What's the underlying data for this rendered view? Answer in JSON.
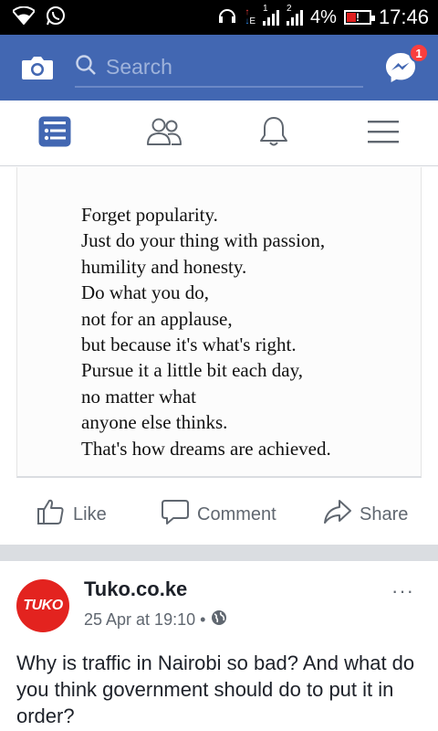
{
  "status_bar": {
    "battery": "4%",
    "time": "17:46",
    "sim1": "1",
    "sim2": "2",
    "network_type": "E"
  },
  "app_bar": {
    "search_placeholder": "Search",
    "messenger_badge": "1",
    "color": "#4267b2"
  },
  "nav_tabs": [
    {
      "name": "news-feed",
      "icon": "news-feed-icon",
      "active": true
    },
    {
      "name": "friends",
      "icon": "friends-icon",
      "active": false
    },
    {
      "name": "notifications",
      "icon": "bell-icon",
      "active": false
    },
    {
      "name": "menu",
      "icon": "hamburger-icon",
      "active": false
    }
  ],
  "post1": {
    "quote_lines": [
      "Forget popularity.",
      "Just do your thing with passion,",
      "humility and honesty.",
      "Do what you do,",
      "not for an applause,",
      "but because it's what's right.",
      "Pursue it a little bit each day,",
      "no matter what",
      "anyone else thinks.",
      "That's how dreams are achieved."
    ],
    "actions": {
      "like": "Like",
      "comment": "Comment",
      "share": "Share"
    }
  },
  "post2": {
    "page_name": "Tuko.co.ke",
    "avatar_text": "TUKO",
    "avatar_color": "#e3231f",
    "timestamp": "25 Apr at 19:10 •",
    "more": "···",
    "text": "Why is traffic in Nairobi so bad? And what do you think government should do to put it in order?"
  }
}
